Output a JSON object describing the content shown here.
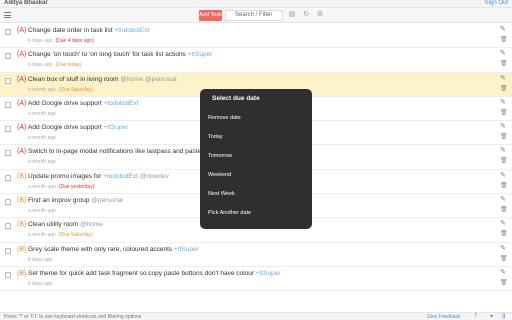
{
  "header": {
    "user": "Aditya Bhaskar",
    "signout": "Sign Out"
  },
  "toolbar": {
    "add_label": "Add Task",
    "search_placeholder": "Search / Filter"
  },
  "tasks": [
    {
      "priority": "(A)",
      "prio_class": "a",
      "text": "Change date order in task list",
      "project": "+todobotExt",
      "context": "",
      "age": "6 days ago",
      "due": "(Due 4 days ago)",
      "due_class": "overdue",
      "highlight": false
    },
    {
      "priority": "(A)",
      "prio_class": "a",
      "text": "Change 'on touch' to 'on long touch' for task list actions",
      "project": "+ttSuper",
      "context": "",
      "age": "6 days ago",
      "due": "(Due today)",
      "due_class": "soon",
      "highlight": false
    },
    {
      "priority": "(A)",
      "prio_class": "a",
      "text": "Clean box of stuff in living room",
      "project": "",
      "context": "@home @personal",
      "age": "a month ago",
      "due": "(Due Saturday)",
      "due_class": "soon",
      "highlight": true
    },
    {
      "priority": "(A)",
      "prio_class": "a",
      "text": "Add Google drive support",
      "project": "+todobotExt",
      "context": "",
      "age": "a month ago",
      "due": "",
      "due_class": "",
      "highlight": false
    },
    {
      "priority": "(A)",
      "prio_class": "a",
      "text": "Add Google drive support",
      "project": "+ttSuper",
      "context": "",
      "age": "a month ago",
      "due": "",
      "due_class": "",
      "highlight": false
    },
    {
      "priority": "(A)",
      "prio_class": "a",
      "text": "Switch to in-page modal notifications like lastpass and pastel ne",
      "project": "",
      "context": "",
      "age": "a month ago",
      "due": "",
      "due_class": "",
      "highlight": false
    },
    {
      "priority": "(B)",
      "prio_class": "b",
      "text": "Update promo images for",
      "project": "+todobotExt",
      "context": "@nowdev",
      "age": "a month ago",
      "due": "(Due yesterday)",
      "due_class": "overdue",
      "highlight": false
    },
    {
      "priority": "(B)",
      "prio_class": "b",
      "text": "Find an improv group",
      "project": "",
      "context": "@personal",
      "age": "a month ago",
      "due": "",
      "due_class": "",
      "highlight": false
    },
    {
      "priority": "(B)",
      "prio_class": "b",
      "text": "Clean utility room",
      "project": "",
      "context": "@home",
      "age": "a month ago",
      "due": "(Due Saturday)",
      "due_class": "soon",
      "highlight": false
    },
    {
      "priority": "(B)",
      "prio_class": "b",
      "text": "Grey scale theme with only rare, coloured accents",
      "project": "+ttSuper",
      "context": "",
      "age": "6 days ago",
      "due": "",
      "due_class": "",
      "highlight": false
    },
    {
      "priority": "(B)",
      "prio_class": "b",
      "text": "Set theme for quick add task fragment so copy paste buttons don't have colour",
      "project": "+ttSuper",
      "context": "",
      "age": "6 days ago",
      "due": "",
      "due_class": "",
      "highlight": false
    }
  ],
  "modal": {
    "title": "Select due date",
    "options": [
      "Remove date",
      "Today",
      "Tomorrow",
      "Weekend",
      "Next Week",
      "Pick Another date"
    ]
  },
  "footer": {
    "hint": "Press '?' or 'F1' to see keyboard shortcuts and filtering options",
    "feedback": "Give Feedback"
  },
  "colors": {
    "accent": "#f06a60",
    "modal_bg": "#2f2f2f",
    "highlight": "#fdf2c8",
    "link": "#4a90d9"
  }
}
